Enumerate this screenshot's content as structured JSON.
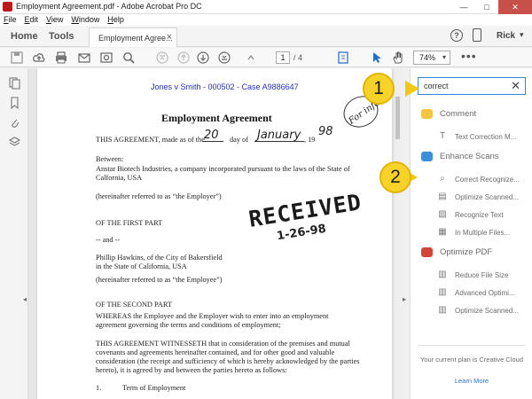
{
  "window": {
    "title": "Employment Agreement.pdf - Adobe Acrobat Pro DC",
    "minimize": "—",
    "maximize": "□",
    "close": "✕"
  },
  "menu": [
    "File",
    "Edit",
    "View",
    "Window",
    "Help"
  ],
  "tabs": {
    "home": "Home",
    "tools": "Tools",
    "document": "Employment Agree...",
    "close": "×"
  },
  "account": {
    "help_glyph": "?",
    "user": "Rick",
    "caret": "▾"
  },
  "toolbar": {
    "current_page": "1",
    "page_total": "/ 4",
    "zoom": "74%",
    "zoom_caret": "▾",
    "more": "•••"
  },
  "document": {
    "case_header": "Jones v Smith - 000502 - Case A9886647",
    "title": "Employment Agreement",
    "lines": [
      "THIS AGREEMENT, made as of the",
      "day of",
      ", 19",
      "Between:",
      "Anstar Biotech Industries, a company incorporated pursuant to the laws of the State of",
      "Calfornia, USA",
      "(hereinafter referred to as “the Employer”)",
      "OF THE FIRST PART",
      "-- and --",
      "Phillip Hawkins, of the City of Bakersfield",
      "in the State of California, USA",
      "(hereinafter referred to as “the Employee”)",
      "OF THE SECOND PART",
      "WHEREAS the Employee and the Employer wish to enter into an employment",
      "agreement governing the terms and conditions of employment;",
      "THIS AGREEMENT WITNESSETH that in consideration of the premises and mutual",
      "covenants and agreements hereinafter contained, and for other good and valuable",
      "consideration (the receipt and sufficiency of which is hereby acknowledged by the parties",
      "hereto), it is agreed by and between the parties hereto as follows:",
      "1.",
      "Term of Employment"
    ],
    "handwritten": {
      "day": "20",
      "month": "January",
      "year": "98",
      "fyi": "For info"
    },
    "stamp": {
      "text": "RECEIVED",
      "date": "1-26-98"
    }
  },
  "callouts": [
    "1",
    "2"
  ],
  "search": {
    "value": "correct",
    "clear": "✕"
  },
  "panel": {
    "sections": [
      {
        "title": "Comment",
        "color": "#f5c642",
        "items": [
          {
            "label": "Text Correction M...",
            "icon": "text-correction-icon"
          }
        ]
      },
      {
        "title": "Enhance Scans",
        "color": "#3b8fd9",
        "items": [
          {
            "label": "Correct Recognize...",
            "icon": "correct-recognize-icon"
          },
          {
            "label": "Optimize Scanned...",
            "icon": "optimize-scanned-icon"
          },
          {
            "label": "Recognize Text",
            "icon": "recognize-text-icon"
          },
          {
            "label": "In Multiple Files...",
            "icon": "multiple-files-icon"
          }
        ]
      },
      {
        "title": "Optimize PDF",
        "color": "#d2443c",
        "items": [
          {
            "label": "Reduce File Size",
            "icon": "reduce-file-icon"
          },
          {
            "label": "Advanced Optimi...",
            "icon": "advanced-optimize-icon"
          },
          {
            "label": "Optimize Scanned...",
            "icon": "optimize-scanned-icon"
          }
        ]
      }
    ],
    "plan_text": "Your current plan is Creative Cloud",
    "learn_more": "Learn More"
  }
}
